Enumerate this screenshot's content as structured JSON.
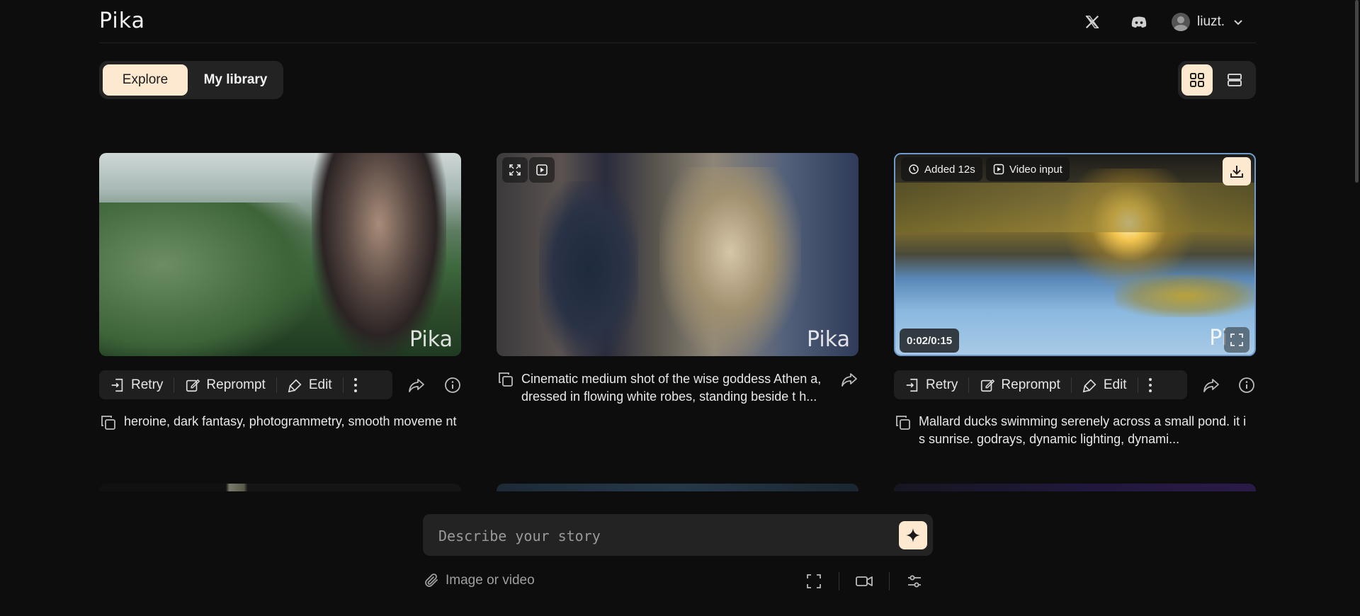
{
  "header": {
    "logo": "Pika",
    "user_name": "liuzt."
  },
  "tabs": [
    {
      "label": "Explore",
      "active": true
    },
    {
      "label": "My library",
      "active": false
    }
  ],
  "cards": [
    {
      "actions": {
        "retry": "Retry",
        "reprompt": "Reprompt",
        "edit": "Edit"
      },
      "prompt": "heroine, dark fantasy, photogrammetry, smooth moveme nt",
      "watermark": "Pika"
    },
    {
      "prompt": "Cinematic medium shot of the wise goddess Athen a, dressed in flowing white robes, standing beside t h...",
      "watermark": "Pika"
    },
    {
      "actions": {
        "retry": "Retry",
        "reprompt": "Reprompt",
        "edit": "Edit"
      },
      "badge_added": "Added 12s",
      "badge_video_input": "Video input",
      "time": "0:02/0:15",
      "prompt": "Mallard ducks swimming serenely across a small pond. it i s sunrise. godrays, dynamic lighting, dynami...",
      "watermark": "Pi"
    }
  ],
  "composer": {
    "placeholder": "Describe your story",
    "attach_label": "Image or video"
  },
  "colors": {
    "accent": "#fde9cf",
    "background": "#0d0d0d",
    "panel": "#232323"
  }
}
